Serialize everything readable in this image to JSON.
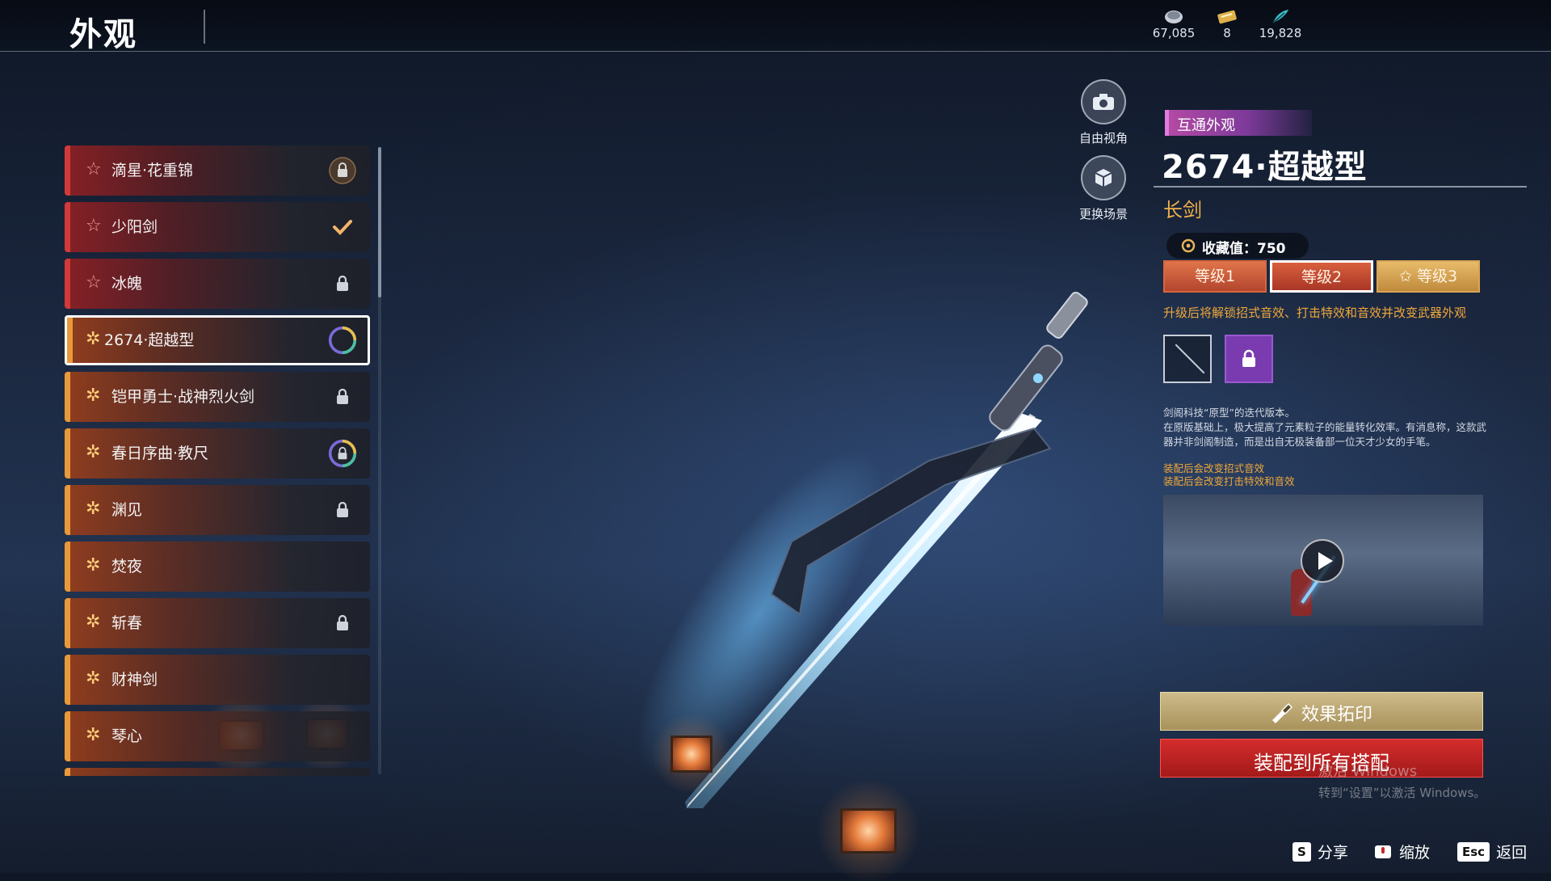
{
  "header": {
    "title": "外观",
    "currencies": [
      {
        "icon": "coin-icon",
        "value": "67,085"
      },
      {
        "icon": "ticket-icon",
        "value": "8"
      },
      {
        "icon": "feather-icon",
        "value": "19,828"
      }
    ]
  },
  "skin_list": {
    "items": [
      {
        "name": "滴星·花重锦",
        "rarity": "red",
        "status": "lock-badge"
      },
      {
        "name": "少阳剑",
        "rarity": "red",
        "status": "equipped"
      },
      {
        "name": "冰魄",
        "rarity": "red",
        "status": "locked"
      },
      {
        "name": "2674·超越型",
        "rarity": "orange",
        "status": "selected-ring"
      },
      {
        "name": "铠甲勇士·战神烈火剑",
        "rarity": "orange",
        "status": "locked"
      },
      {
        "name": "春日序曲·教尺",
        "rarity": "orange",
        "status": "locked-ring"
      },
      {
        "name": "渊见",
        "rarity": "orange",
        "status": "locked"
      },
      {
        "name": "焚夜",
        "rarity": "orange",
        "status": "none"
      },
      {
        "name": "斩春",
        "rarity": "orange",
        "status": "locked"
      },
      {
        "name": "财神剑",
        "rarity": "orange",
        "status": "none"
      },
      {
        "name": "琴心",
        "rarity": "orange",
        "status": "none"
      }
    ]
  },
  "camera": {
    "free_view_label": "自由视角",
    "change_scene_label": "更换场景"
  },
  "detail": {
    "tag": "互通外观",
    "name": "2674·超越型",
    "weapon_type": "长剑",
    "collection_value": "收藏值：750",
    "tiers": [
      "等级1",
      "等级2",
      "等级3"
    ],
    "selected_tier": "等级2",
    "upgrade_note": "升级后将解锁招式音效、打击特效和音效并改变武器外观",
    "description_line1": "剑阁科技“原型”的迭代版本。",
    "description_line2": "在原版基础上，极大提高了元素粒子的能量转化效率。有消息称，这款武器并非剑阁制造，而是出自无极装备部一位天才少女的手笔。",
    "effect_line1": "装配后会改变招式音效",
    "effect_line2": "装配后会改变打击特效和音效",
    "take_effect_button": "效果拓印",
    "equip_all_button": "装配到所有搭配",
    "watermark_line1": "激活 Windows",
    "watermark_line2": "转到“设置”以激活 Windows。"
  },
  "footer": {
    "share_key": "S",
    "share_label": "分享",
    "zoom_label": "缩放",
    "back_key": "Esc",
    "back_label": "返回"
  },
  "colors": {
    "accent_gold": "#f0b04a",
    "equip_red": "#c92424",
    "rarity_red": "#d23a3a",
    "rarity_orange": "#e89a3a",
    "tag_purple": "#b24aa4"
  }
}
